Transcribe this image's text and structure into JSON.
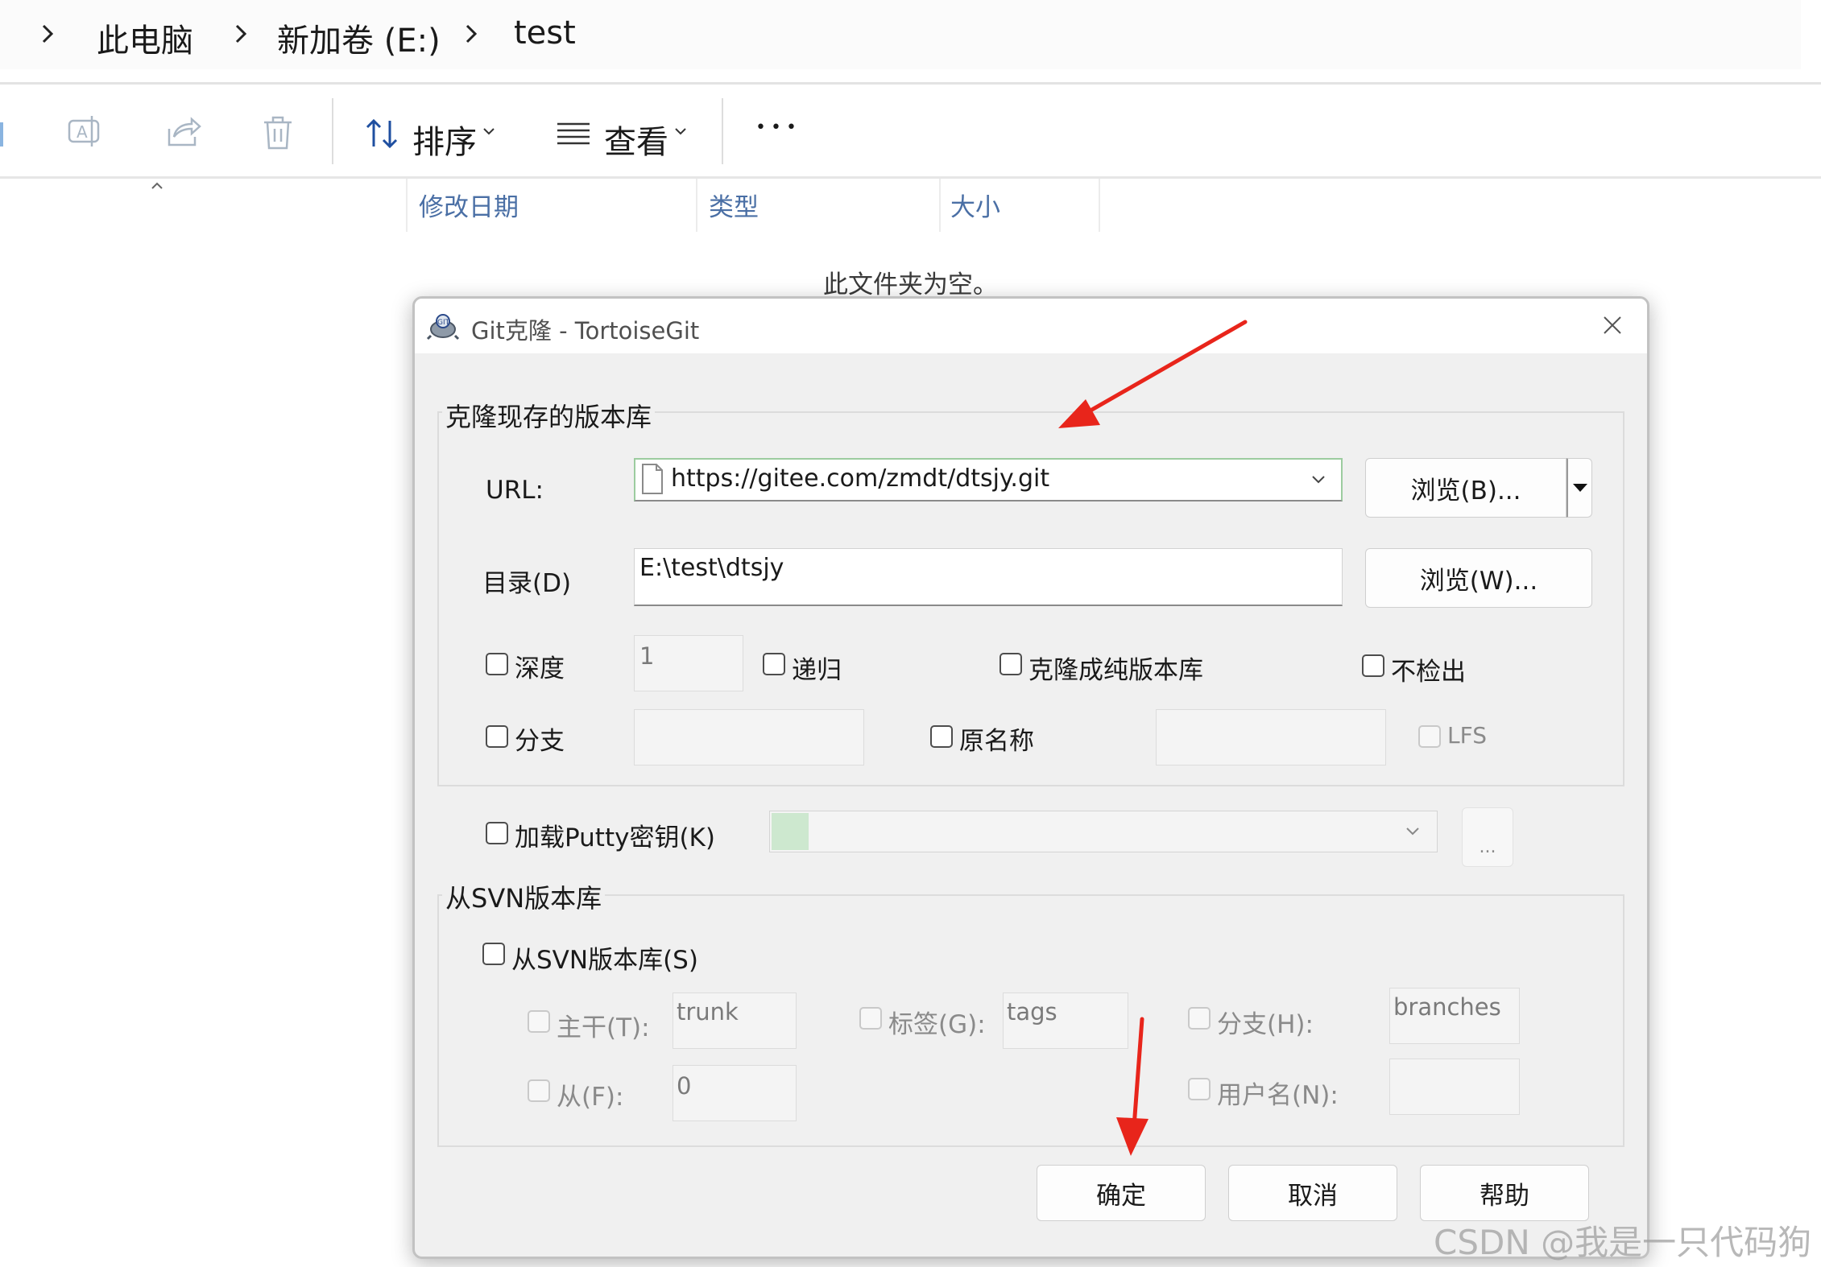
{
  "breadcrumb": {
    "items": [
      "此电脑",
      "新加卷 (E:)",
      "test"
    ]
  },
  "toolbar": {
    "sort_label": "排序",
    "view_label": "查看",
    "more_label": "•••"
  },
  "columns": {
    "modified": "修改日期",
    "type": "类型",
    "size": "大小"
  },
  "empty_message": "此文件夹为空。",
  "dialog": {
    "title": "Git克隆 - TortoiseGit",
    "clone_group": {
      "label": "克隆现存的版本库",
      "url_label": "URL:",
      "url_value": "https://gitee.com/zmdt/dtsjy.git",
      "browse_b": "浏览(B)...",
      "dir_label": "目录(D)",
      "dir_value": "E:\\test\\dtsjy",
      "browse_w": "浏览(W)...",
      "depth_label": "深度",
      "depth_value": "1",
      "recursive_label": "递归",
      "bare_label": "克隆成纯版本库",
      "no_checkout_label": "不检出",
      "branch_label": "分支",
      "origin_label": "原名称",
      "lfs_label": "LFS"
    },
    "putty": {
      "label": "加载Putty密钥(K)",
      "browse": "..."
    },
    "svn_group": {
      "label": "从SVN版本库",
      "from_svn_label": "从SVN版本库(S)",
      "trunk_label": "主干(T):",
      "trunk_value": "trunk",
      "tags_label": "标签(G):",
      "tags_value": "tags",
      "branches_label": "分支(H):",
      "branches_value": "branches",
      "from_label": "从(F):",
      "from_value": "0",
      "username_label": "用户名(N):"
    },
    "buttons": {
      "ok": "确定",
      "cancel": "取消",
      "help": "帮助"
    }
  },
  "watermark": "CSDN @我是一只代码狗",
  "colors": {
    "annotation_arrow": "#e8251b",
    "accent_green": "#cde8cf",
    "column_header": "#4a6fa5"
  }
}
